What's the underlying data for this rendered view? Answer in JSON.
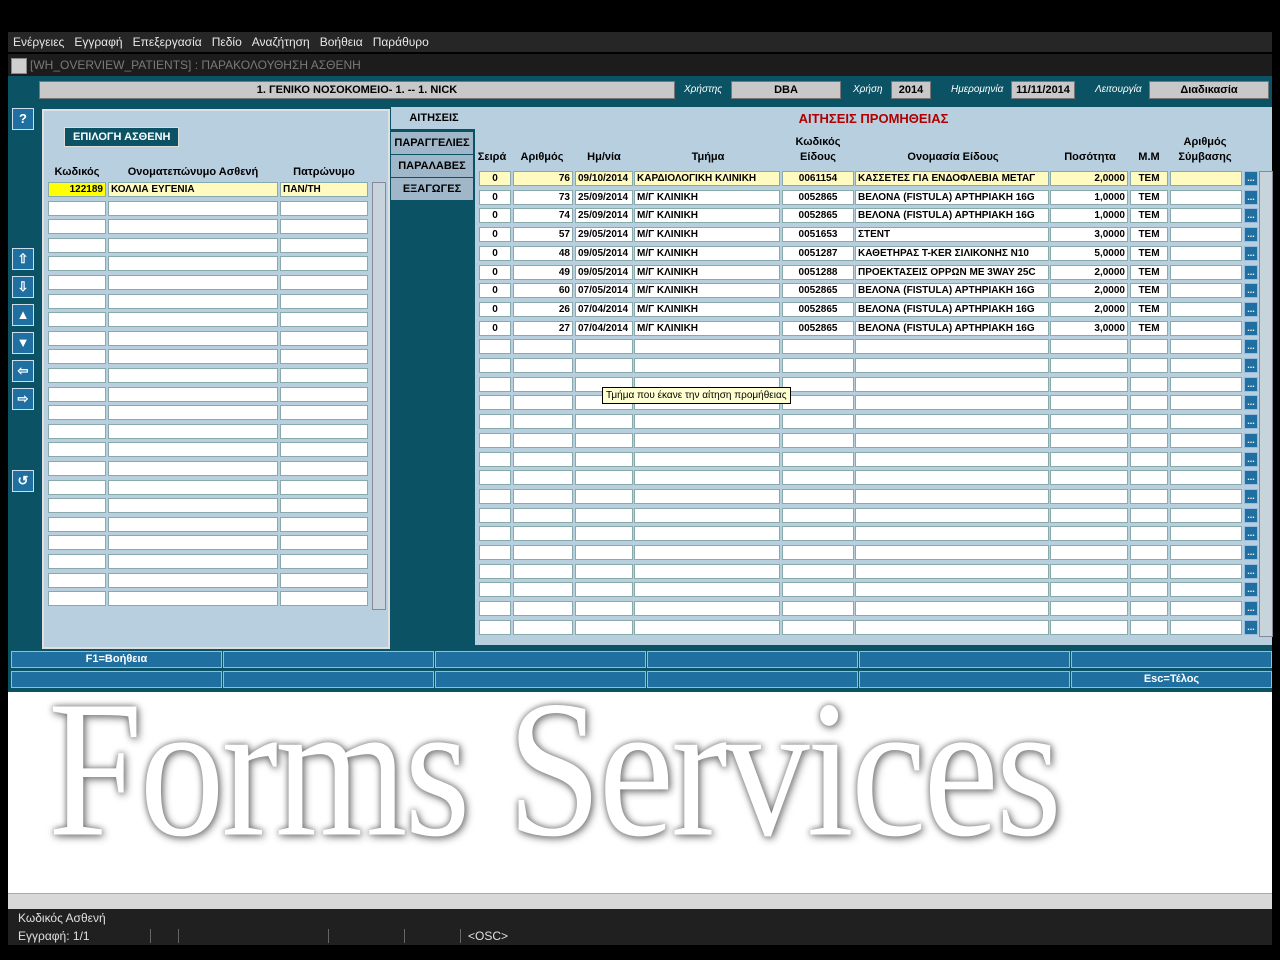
{
  "menu": [
    "Ενέργειες",
    "Εγγραφή",
    "Επεξεργασία",
    "Πεδίο",
    "Αναζήτηση",
    "Βοήθεια",
    "Παράθυρο"
  ],
  "window_title": "[WH_OVERVIEW_PATIENTS]   :   ΠΑΡΑΚΟΛΟΥΘΗΣΗ ΑΣΘΕΝΗ",
  "header": {
    "hospital": "1. ΓΕΝΙΚΟ ΝΟΣΟΚΟΜΕΙΟ- 1. -- 1. NICK",
    "user_label": "Χρήστης",
    "user_value": "DBA",
    "year_label": "Χρήση",
    "year_value": "2014",
    "date_label": "Ημερομηνία",
    "date_value": "11/11/2014",
    "function_label": "Λειτουργία",
    "function_value": "Διαδικασία"
  },
  "left": {
    "frame_title": "ΕΠΙΛΟΓΗ ΑΣΘΕΝΗ",
    "col_code": "Κωδικός",
    "col_name": "Ονοματεπώνυμο Ασθενή",
    "col_father": "Πατρώνυμο",
    "patient_code": "122189",
    "patient_name": "ΚΟΛΛΙΑ  ΕΥΓΕΝΙΑ",
    "patient_father": "ΠΑΝ/ΤΗ"
  },
  "tabs": [
    "ΑΙΤΗΣΕΙΣ",
    "ΠΑΡΑΓΓΕΛΙΕΣ",
    "ΠΑΡΑΛΑΒΕΣ",
    "ΕΞΑΓΩΓΕΣ"
  ],
  "right": {
    "title": "ΑΙΤΗΣΕΙΣ ΠΡΟΜΗΘΕΙΑΣ",
    "columns": {
      "seira": "Σειρά",
      "arithmos": "Αριθμός",
      "date": "Ημ/νία",
      "dept": "Τμήμα",
      "code1": "Κωδικός",
      "code2": "Είδους",
      "item": "Ονομασία Είδους",
      "qty": "Ποσότητα",
      "unit": "Μ.Μ",
      "contract1": "Αριθμός",
      "contract2": "Σύμβασης"
    },
    "rows": [
      {
        "seira": "0",
        "num": "76",
        "date": "09/10/2014",
        "dept": "ΚΑΡΔΙΟΛΟΓΙΚΗ ΚΛΙΝΙΚΗ",
        "code": "0061154",
        "item": "ΚΑΣΣΕΤΕΣ ΓΙΑ ΕΝΔΟΦΛΕΒΙΑ ΜΕΤΑΓ",
        "qty": "2,0000",
        "unit": "ΤΕΜ",
        "contract": ""
      },
      {
        "seira": "0",
        "num": "73",
        "date": "25/09/2014",
        "dept": "Μ/Γ  ΚΛΙΝΙΚΗ",
        "code": "0052865",
        "item": "ΒΕΛΟΝΑ (FISTULA) ΑΡΤΗΡΙΑΚΗ 16G",
        "qty": "1,0000",
        "unit": "ΤΕΜ",
        "contract": ""
      },
      {
        "seira": "0",
        "num": "74",
        "date": "25/09/2014",
        "dept": "Μ/Γ  ΚΛΙΝΙΚΗ",
        "code": "0052865",
        "item": "ΒΕΛΟΝΑ (FISTULA) ΑΡΤΗΡΙΑΚΗ 16G",
        "qty": "1,0000",
        "unit": "ΤΕΜ",
        "contract": ""
      },
      {
        "seira": "0",
        "num": "57",
        "date": "29/05/2014",
        "dept": "Μ/Γ  ΚΛΙΝΙΚΗ",
        "code": "0051653",
        "item": " ΣΤΕΝΤ",
        "qty": "3,0000",
        "unit": "ΤΕΜ",
        "contract": ""
      },
      {
        "seira": "0",
        "num": "48",
        "date": "09/05/2014",
        "dept": "Μ/Γ  ΚΛΙΝΙΚΗ",
        "code": "0051287",
        "item": "ΚΑΘΕΤΗΡΑΣ Τ-KER ΣΙΛΙΚΟΝΗΣ Ν10",
        "qty": "5,0000",
        "unit": "ΤΕΜ",
        "contract": ""
      },
      {
        "seira": "0",
        "num": "49",
        "date": "09/05/2014",
        "dept": "Μ/Γ  ΚΛΙΝΙΚΗ",
        "code": "0051288",
        "item": "ΠΡΟΕΚΤΑΣΕΙΣ ΟΡΡΩΝ ΜΕ 3WAY 25C",
        "qty": "2,0000",
        "unit": "ΤΕΜ",
        "contract": ""
      },
      {
        "seira": "0",
        "num": "60",
        "date": "07/05/2014",
        "dept": "Μ/Γ  ΚΛΙΝΙΚΗ",
        "code": "0052865",
        "item": "ΒΕΛΟΝΑ (FISTULA) ΑΡΤΗΡΙΑΚΗ 16G",
        "qty": "2,0000",
        "unit": "ΤΕΜ",
        "contract": ""
      },
      {
        "seira": "0",
        "num": "26",
        "date": "07/04/2014",
        "dept": "Μ/Γ  ΚΛΙΝΙΚΗ",
        "code": "0052865",
        "item": "ΒΕΛΟΝΑ (FISTULA) ΑΡΤΗΡΙΑΚΗ 16G",
        "qty": "2,0000",
        "unit": "ΤΕΜ",
        "contract": ""
      },
      {
        "seira": "0",
        "num": "27",
        "date": "07/04/2014",
        "dept": "Μ/Γ  ΚΛΙΝΙΚΗ",
        "code": "0052865",
        "item": "ΒΕΛΟΝΑ (FISTULA) ΑΡΤΗΡΙΑΚΗ 16G",
        "qty": "3,0000",
        "unit": "ΤΕΜ",
        "contract": ""
      }
    ],
    "dots_label": "..."
  },
  "tooltip": "Τμήμα που έκανε την αίτηση προμήθειας",
  "footer_buttons": {
    "help": "F1=Βοήθεια",
    "exit": "Esc=Τέλος"
  },
  "watermark": "Forms Services",
  "status": {
    "field_hint": "Κωδικός Ασθενή",
    "record": "Εγγραφή: 1/1",
    "mode": "<OSC>"
  }
}
